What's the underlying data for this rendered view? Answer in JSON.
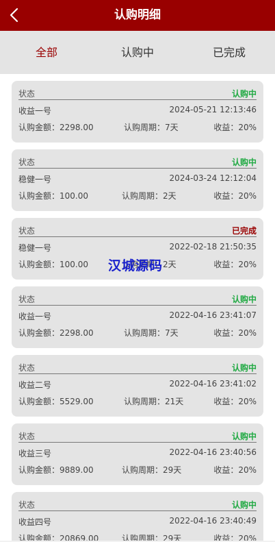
{
  "header": {
    "title": "认购明细"
  },
  "tabs": [
    {
      "label": "全部",
      "active": true
    },
    {
      "label": "认购中",
      "active": false
    },
    {
      "label": "已完成",
      "active": false
    }
  ],
  "status_label": "状态",
  "records": [
    {
      "status": "认购中",
      "status_color": "#22aa44",
      "name": "收益一号",
      "time": "2024-05-21 12:13:46",
      "amount": "认购金额：2298.00",
      "period": "认购周期：7天",
      "yield": "收益：20%"
    },
    {
      "status": "认购中",
      "status_color": "#22aa44",
      "name": "稳健一号",
      "time": "2024-03-24 12:12:04",
      "amount": "认购金额：100.00",
      "period": "认购周期：2天",
      "yield": "收益：20%"
    },
    {
      "status": "已完成",
      "status_color": "#990000",
      "name": "稳健一号",
      "time": "2022-02-18 21:50:35",
      "amount": "认购金额：100.00",
      "period": "认购周期：2天",
      "yield": "收益：20%"
    },
    {
      "status": "认购中",
      "status_color": "#22aa44",
      "name": "收益一号",
      "time": "2022-04-16 23:41:07",
      "amount": "认购金额：2298.00",
      "period": "认购周期：7天",
      "yield": "收益：20%"
    },
    {
      "status": "认购中",
      "status_color": "#22aa44",
      "name": "收益二号",
      "time": "2022-04-16 23:41:02",
      "amount": "认购金额：5529.00",
      "period": "认购周期：21天",
      "yield": "收益：20%"
    },
    {
      "status": "认购中",
      "status_color": "#22aa44",
      "name": "收益三号",
      "time": "2022-04-16 23:40:56",
      "amount": "认购金额：9889.00",
      "period": "认购周期：29天",
      "yield": "收益：20%"
    },
    {
      "status": "认购中",
      "status_color": "#22aa44",
      "name": "收益四号",
      "time": "2022-04-16 23:40:49",
      "amount": "认购金额：20869.00",
      "period": "认购周期：29天",
      "yield": "收益：20%"
    }
  ],
  "watermark": "汉城源码",
  "colors": {
    "brand": "#990000",
    "active_status": "#22aa44",
    "done_status": "#990000"
  },
  "icons": {
    "back": "chevron-left-icon"
  }
}
